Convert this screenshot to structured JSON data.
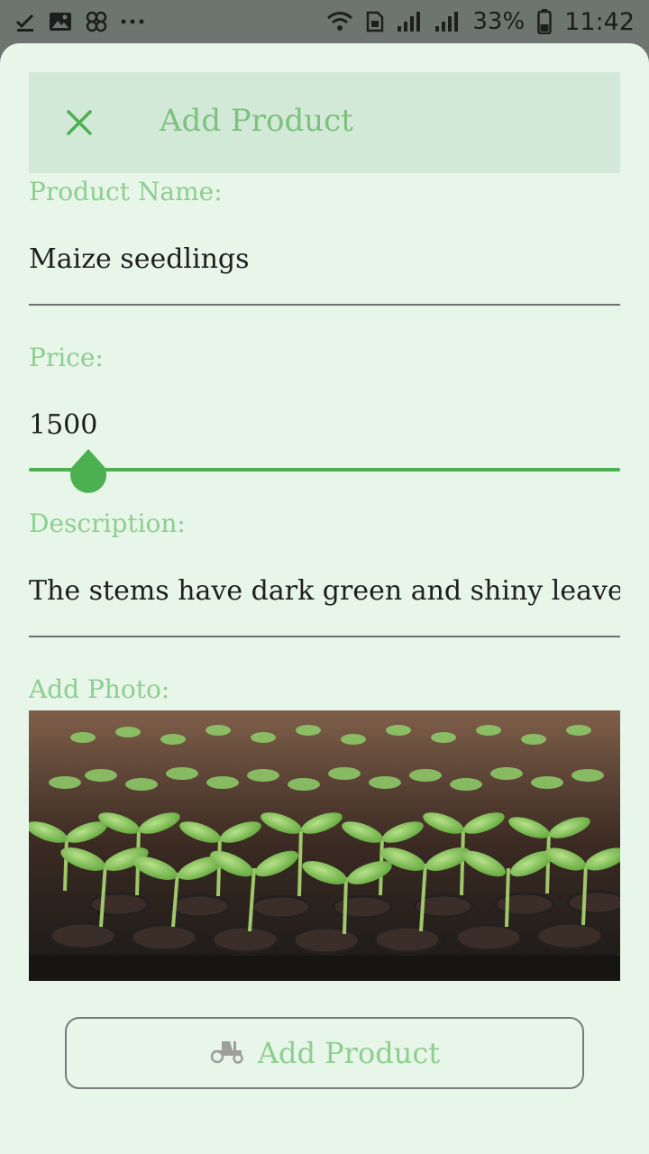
{
  "status_bar": {
    "time": "11:42",
    "battery_percent": "33%",
    "left_icons": [
      "check-download-icon",
      "image-icon",
      "pinwheel-icon",
      "more-dots-icon"
    ],
    "right_icons": [
      "wifi-icon",
      "sim-icon",
      "signal-icon",
      "signal-icon",
      "battery-icon"
    ]
  },
  "header": {
    "title": "Add Product",
    "close_icon": "close-icon"
  },
  "form": {
    "product_name": {
      "label": "Product Name:",
      "value": "Maize seedlings"
    },
    "price": {
      "label": "Price:",
      "value": "1500",
      "slider_fraction": 0.1
    },
    "description": {
      "label": "Description:",
      "value": "The stems have dark green and shiny leaves"
    },
    "photo": {
      "label": "Add Photo:",
      "subject": "green seedlings in a seed tray"
    }
  },
  "submit": {
    "label": "Add Product",
    "icon": "tractor-icon"
  },
  "colors": {
    "accent": "#4caf50",
    "label_green": "#8ccf8f",
    "sheet_bg": "#e8f5e9",
    "header_bg": "#d3e9d7"
  }
}
